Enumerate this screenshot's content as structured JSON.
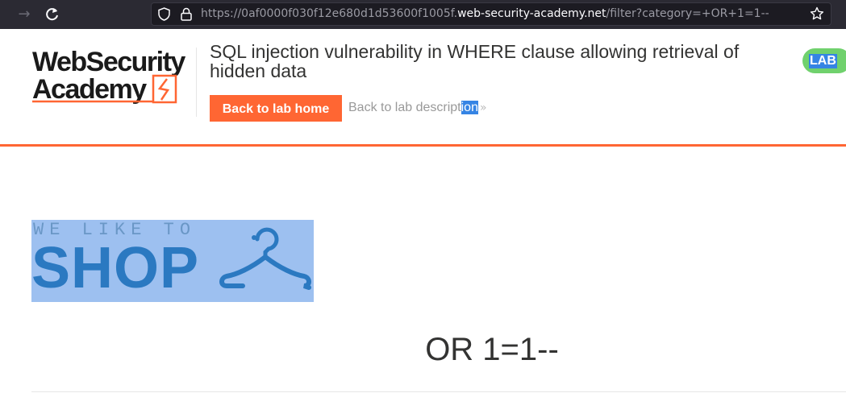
{
  "browser": {
    "url_prefix": "https://0af0000f030f12e680d1d53600f1005f.",
    "url_host": "web-security-academy.net",
    "url_path": "/filter?category=+OR+1=1--",
    "icons": [
      "back-arrow-icon",
      "reload-icon",
      "shield-icon",
      "lock-icon",
      "star-icon"
    ]
  },
  "header": {
    "logo_line1": "WebSecurity",
    "logo_line2": "Academy",
    "lab_title": "SQL injection vulnerability in WHERE clause allowing retrieval of hidden data",
    "back_home_label": "Back to lab home",
    "back_desc_label_plain": "Back to lab descript",
    "back_desc_label_selected": "ion",
    "lab_badge": "LAB"
  },
  "banner": {
    "tagline": "WE LIKE TO",
    "word": "SHOP"
  },
  "content": {
    "search_heading": "OR 1=1--"
  },
  "colors": {
    "brand_orange": "#ff6633",
    "badge_green": "#70d16d",
    "selection_blue": "#3584e4",
    "banner_blue": "#2b79c1",
    "banner_highlight": "#9dc0f0"
  }
}
